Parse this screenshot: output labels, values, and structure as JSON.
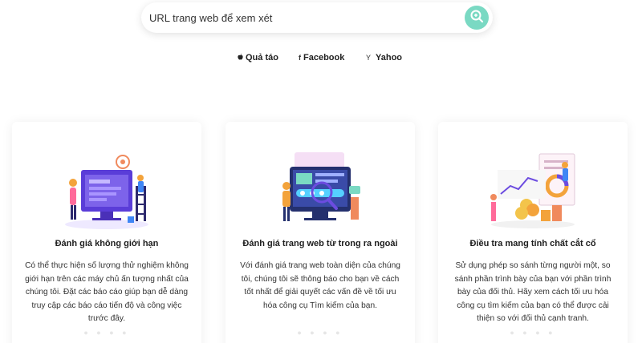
{
  "search": {
    "placeholder": "URL trang web để xem xét"
  },
  "engines": [
    {
      "icon": "apple-icon",
      "glyph": "",
      "label": "Quả táo"
    },
    {
      "icon": "facebook-icon",
      "glyph": "f",
      "label": "Facebook"
    },
    {
      "icon": "yahoo-icon",
      "glyph": "Y",
      "label": "Yahoo"
    }
  ],
  "cards": [
    {
      "title": "Đánh giá không giới hạn",
      "body": "Có thể thực hiện số lượng thử nghiệm không giới hạn trên các máy chủ ấn tượng nhất của chúng tôi. Đặt các báo cáo giúp bạn dễ dàng truy cập các báo cáo tiến độ và công việc trước đây."
    },
    {
      "title": "Đánh giá trang web từ trong ra ngoài",
      "body": "Với đánh giá trang web toàn diện của chúng tôi, chúng tôi sẽ thông báo cho bạn về cách tốt nhất để giải quyết các vấn đề về tối ưu hóa công cụ Tìm kiếm của bạn."
    },
    {
      "title": "Điều tra mang tính chất cắt cổ",
      "body": "Sử dụng phép so sánh từng người một, so sánh phần trình bày của bạn với phần trình bày của đối thủ. Hãy xem cách tối ưu hóa công cụ tìm kiếm của bạn có thể được cải thiện so với đối thủ cạnh tranh."
    }
  ],
  "colors": {
    "accent": "#7ad9c3",
    "illustration_purple": "#6c4ce0",
    "illustration_orange": "#f3a33b"
  }
}
